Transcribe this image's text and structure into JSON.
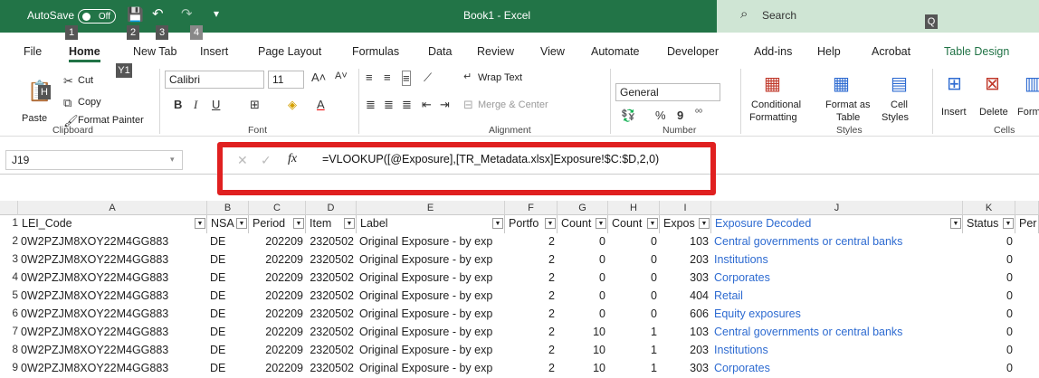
{
  "titlebar": {
    "autosave_label": "AutoSave",
    "autosave_state": "Off",
    "title": "Book1 - Excel",
    "search_placeholder": "Search",
    "keytips": {
      "autosave": "1",
      "save": "2",
      "undo": "3",
      "redo": "4",
      "search": "Q"
    }
  },
  "tabs": [
    {
      "label": "File",
      "keytip": "F"
    },
    {
      "label": "Home",
      "keytip": "H"
    },
    {
      "label": "New Tab",
      "keytip": "Y1"
    },
    {
      "label": "Insert",
      "keytip": "N"
    },
    {
      "label": "Page Layout",
      "keytip": "P1"
    },
    {
      "label": "Formulas",
      "keytip": "M"
    },
    {
      "label": "Data",
      "keytip": "A"
    },
    {
      "label": "Review",
      "keytip": "R"
    },
    {
      "label": "View",
      "keytip": "W"
    },
    {
      "label": "Automate",
      "keytip": "U"
    },
    {
      "label": "Developer",
      "keytip": "L"
    },
    {
      "label": "Add-ins",
      "keytip": "X"
    },
    {
      "label": "Help",
      "keytip": "Y2"
    },
    {
      "label": "Acrobat",
      "keytip": "B"
    },
    {
      "label": "Table Design",
      "keytip": "JT"
    }
  ],
  "ribbon": {
    "clipboard": {
      "paste": "Paste",
      "cut": "Cut",
      "copy": "Copy",
      "format_painter": "Format Painter",
      "group": "Clipboard"
    },
    "font": {
      "name": "Calibri",
      "size": "11",
      "bold": "B",
      "italic": "I",
      "underline": "U",
      "grow": "A˄",
      "shrink": "A˅",
      "group": "Font"
    },
    "alignment": {
      "wrap": "Wrap Text",
      "merge": "Merge & Center",
      "group": "Alignment"
    },
    "number": {
      "format": "General",
      "percent": "%",
      "comma": "9",
      "group": "Number"
    },
    "styles": {
      "conditional": "Conditional",
      "formatting": "Formatting",
      "format_as": "Format as",
      "table": "Table",
      "cell": "Cell",
      "cell_styles": "Styles",
      "group": "Styles"
    },
    "cells": {
      "insert": "Insert",
      "delete": "Delete",
      "format": "Form",
      "group": "Cells"
    }
  },
  "formula_bar": {
    "cell_ref": "J19",
    "fx": "fx",
    "formula": "=VLOOKUP([@Exposure],[TR_Metadata.xlsx]Exposure!$C:$D,2,0)"
  },
  "grid": {
    "columns": [
      "A",
      "B",
      "C",
      "D",
      "E",
      "F",
      "G",
      "H",
      "I",
      "J",
      "K"
    ],
    "headers": [
      "LEI_Code",
      "NSA",
      "Period",
      "Item",
      "Label",
      "Portfo",
      "Count",
      "Count",
      "Expos",
      "Exposure Decoded",
      "Status",
      "Per"
    ],
    "rows": [
      [
        "0W2PZJM8XOY22M4GG883",
        "DE",
        "202209",
        "2320502",
        "Original Exposure - by exp",
        "2",
        "0",
        "0",
        "103",
        "Central governments or central banks",
        "0"
      ],
      [
        "0W2PZJM8XOY22M4GG883",
        "DE",
        "202209",
        "2320502",
        "Original Exposure - by exp",
        "2",
        "0",
        "0",
        "203",
        "Institutions",
        "0"
      ],
      [
        "0W2PZJM8XOY22M4GG883",
        "DE",
        "202209",
        "2320502",
        "Original Exposure - by exp",
        "2",
        "0",
        "0",
        "303",
        "Corporates",
        "0"
      ],
      [
        "0W2PZJM8XOY22M4GG883",
        "DE",
        "202209",
        "2320502",
        "Original Exposure - by exp",
        "2",
        "0",
        "0",
        "404",
        "Retail",
        "0"
      ],
      [
        "0W2PZJM8XOY22M4GG883",
        "DE",
        "202209",
        "2320502",
        "Original Exposure - by exp",
        "2",
        "0",
        "0",
        "606",
        "Equity exposures",
        "0"
      ],
      [
        "0W2PZJM8XOY22M4GG883",
        "DE",
        "202209",
        "2320502",
        "Original Exposure - by exp",
        "2",
        "10",
        "1",
        "103",
        "Central governments or central banks",
        "0"
      ],
      [
        "0W2PZJM8XOY22M4GG883",
        "DE",
        "202209",
        "2320502",
        "Original Exposure - by exp",
        "2",
        "10",
        "1",
        "203",
        "Institutions",
        "0"
      ],
      [
        "0W2PZJM8XOY22M4GG883",
        "DE",
        "202209",
        "2320502",
        "Original Exposure - by exp",
        "2",
        "10",
        "1",
        "303",
        "Corporates",
        "0"
      ]
    ]
  }
}
